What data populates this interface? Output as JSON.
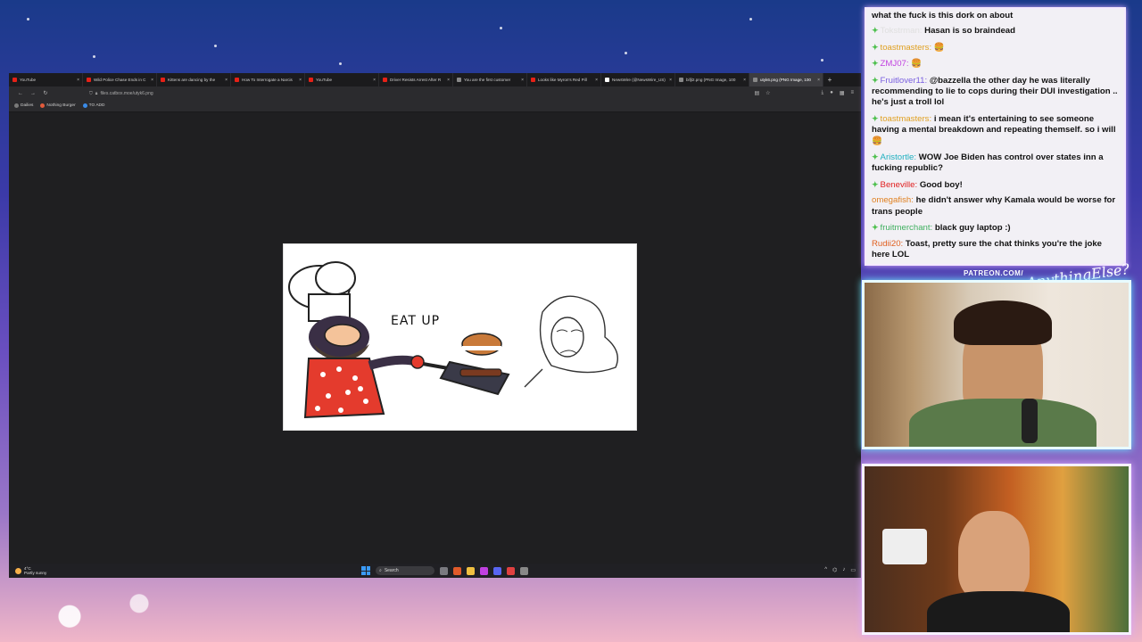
{
  "browser": {
    "tabs": [
      {
        "label": "YouTube",
        "color": "#e62117"
      },
      {
        "label": "Wild Police Chase Ends in C",
        "color": "#e62117"
      },
      {
        "label": "Kittens are dancing by the",
        "color": "#e62117"
      },
      {
        "label": "How To Interrogate a Narcis",
        "color": "#e62117"
      },
      {
        "label": "YouTube",
        "color": "#e62117"
      },
      {
        "label": "Driver Resists Arrest After R",
        "color": "#e62117"
      },
      {
        "label": "You are the first customer",
        "color": "#888888"
      },
      {
        "label": "Looks like Myron's Red Pill",
        "color": "#e62117"
      },
      {
        "label": "NewsWire (@NewsWire_US)",
        "color": "#ffffff"
      },
      {
        "label": "bifjl2.png (PNG Image, 100",
        "color": "#888888"
      },
      {
        "label": "utyk6.png (PNG Image, 100",
        "color": "#888888",
        "active": true
      }
    ],
    "new_tab": "+",
    "url": "files.catbox.moe/utyk6.png",
    "bookmarks": [
      {
        "label": "Dailies",
        "color": "#7a7a7a"
      },
      {
        "label": "Nothing Burger",
        "color": "#e25b3c"
      },
      {
        "label": "TO ADD",
        "color": "#3a8be8"
      }
    ],
    "image_caption": "EAT UP"
  },
  "taskbar": {
    "temperature": "4°C",
    "weather": "Partly sunny",
    "search_label": "Search"
  },
  "chat": [
    {
      "user": "",
      "text": "what the fuck is this dork on about",
      "color": "#111111",
      "badge": false
    },
    {
      "user": "Tokstrman:",
      "text": "Hasan is so braindead",
      "color": "#e0e0e0",
      "badge": true
    },
    {
      "user": "toastmasters:",
      "text": "🍔",
      "color": "#e0a020",
      "badge": true
    },
    {
      "user": "ZMJ07:",
      "text": "🍔",
      "color": "#c040e0",
      "badge": true
    },
    {
      "user": "Fruitlover11:",
      "text": "@bazzella the other day he was literally recommending to lie to cops during their DUI investigation .. he's just a troll lol",
      "color": "#7a60e0",
      "badge": true
    },
    {
      "user": "toastmasters:",
      "text": "i mean it's entertaining to see someone having a mental breakdown and repeating themself. so i will 🍔",
      "color": "#e0a020",
      "badge": true
    },
    {
      "user": "Aristortle:",
      "text": "WOW Joe Biden has control over states inn a fucking republic?",
      "color": "#20b0c0",
      "badge": true
    },
    {
      "user": "Beneville:",
      "text": "Good boy!",
      "color": "#e02020",
      "badge": true
    },
    {
      "user": "omegafish:",
      "text": "he didn't answer why Kamala would be worse for trans people",
      "color": "#e08020",
      "badge": false
    },
    {
      "user": "fruitmerchant:",
      "text": "black guy laptop :)",
      "color": "#40b060",
      "badge": true
    },
    {
      "user": "Rudii20:",
      "text": "Toast, pretty sure the chat thinks you're the joke here LOL",
      "color": "#e06020",
      "badge": false
    }
  ],
  "overlay": {
    "patreon": "PATREON.COM/",
    "signature": "AnythingElse?"
  }
}
